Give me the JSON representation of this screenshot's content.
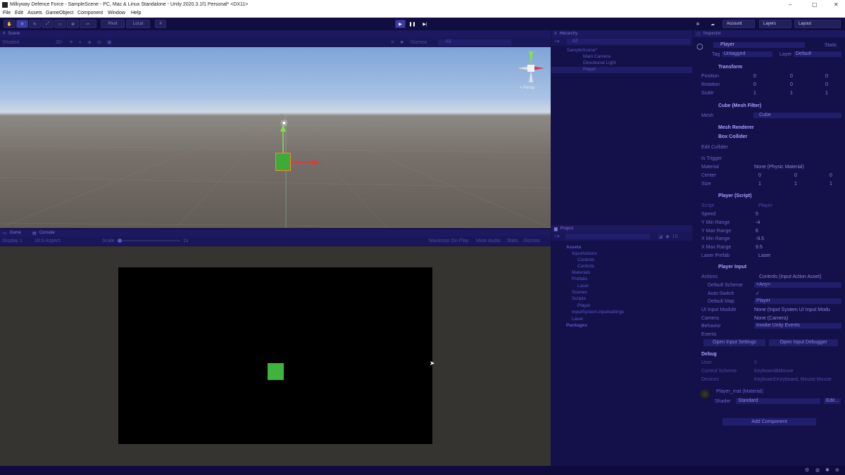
{
  "window": {
    "title": "Milkyway Defence Force - SampleScene - PC, Mac & Linux Standalone - Unity 2020.3.1f1 Personal* <DX11>",
    "min": "–",
    "max": "▢",
    "close": "✕"
  },
  "menu": [
    "File",
    "Edit",
    "Assets",
    "GameObject",
    "Component",
    "Window",
    "Help"
  ],
  "toolbar": {
    "pivot": "Pivot",
    "local": "Local",
    "account": "Account",
    "layers": "Layers",
    "layout": "Layout"
  },
  "scene": {
    "tab": "Scene",
    "shading": "Shaded",
    "twod": "2D",
    "gizmos": "Gizmos",
    "search": "All",
    "persp": "< Persp"
  },
  "game": {
    "tab_game": "Game",
    "tab_console": "Console",
    "display": "Display 1",
    "aspect": "16:9 Aspect",
    "scale_label": "Scale",
    "scale_value": "1x",
    "maximize": "Maximize On Play",
    "mute": "Mute Audio",
    "stats": "Stats",
    "gizmos": "Gizmos"
  },
  "hierarchy": {
    "tab": "Hierarchy",
    "search": "All",
    "items": [
      {
        "label": "SampleScene*",
        "depth": 0
      },
      {
        "label": "Main Camera",
        "depth": 1
      },
      {
        "label": "Directional Light",
        "depth": 1
      },
      {
        "label": "Player",
        "depth": 1
      }
    ]
  },
  "project": {
    "tab": "Project",
    "count": "10",
    "items": [
      {
        "label": "Assets",
        "depth": 0,
        "bold": true
      },
      {
        "label": "InputActions",
        "depth": 1
      },
      {
        "label": "Controls",
        "depth": 2
      },
      {
        "label": "Controls",
        "depth": 2
      },
      {
        "label": "Materials",
        "depth": 1
      },
      {
        "label": "Prefabs",
        "depth": 1
      },
      {
        "label": "Laser",
        "depth": 2
      },
      {
        "label": "Scenes",
        "depth": 1
      },
      {
        "label": "Scripts",
        "depth": 1
      },
      {
        "label": "Player",
        "depth": 2
      },
      {
        "label": "InputSystem.inputsettings",
        "depth": 1
      },
      {
        "label": "Laser",
        "depth": 1
      },
      {
        "label": "Packages",
        "depth": 0,
        "bold": true
      }
    ]
  },
  "inspector": {
    "tab": "Inspector",
    "name": "Player",
    "static": "Static",
    "tag_label": "Tag",
    "tag": "Untagged",
    "layer_label": "Layer",
    "layer": "Default",
    "transform": {
      "title": "Transform",
      "rows": [
        {
          "label": "Position",
          "x": "0",
          "y": "0",
          "z": "0"
        },
        {
          "label": "Rotation",
          "x": "0",
          "y": "0",
          "z": "0"
        },
        {
          "label": "Scale",
          "x": "1",
          "y": "1",
          "z": "1"
        }
      ]
    },
    "meshfilter": {
      "title": "Cube (Mesh Filter)",
      "mesh_label": "Mesh",
      "mesh": "Cube"
    },
    "renderer": {
      "title": "Mesh Renderer"
    },
    "collider": {
      "title": "Box Collider",
      "edit": "Edit Collider",
      "trigger": "Is Trigger",
      "material_label": "Material",
      "material": "None (Physic Material)",
      "center_label": "Center",
      "center": {
        "x": "0",
        "y": "0",
        "z": "0"
      },
      "size_label": "Size",
      "size": {
        "x": "1",
        "y": "1",
        "z": "1"
      }
    },
    "script": {
      "title": "Player (Script)",
      "script_label": "Script",
      "script": "Player",
      "rows": [
        {
          "label": "Speed",
          "value": "5"
        },
        {
          "label": "Y Min Range",
          "value": "-4"
        },
        {
          "label": "Y Max Range",
          "value": "6"
        },
        {
          "label": "X Min Range",
          "value": "-9.5"
        },
        {
          "label": "X Max Range",
          "value": "9.5"
        },
        {
          "label": "Laser Prefab",
          "value": "Laser"
        }
      ]
    },
    "playerinput": {
      "title": "Player Input",
      "actions_label": "Actions",
      "actions": "Controls (Input Action Asset)",
      "scheme_label": "Default Scheme",
      "scheme": "<Any>",
      "autoswitch_label": "Auto-Switch",
      "map_label": "Default Map",
      "map": "Player",
      "ui_label": "UI Input Module",
      "ui": "None (Input System UI Input Modu",
      "camera_label": "Camera",
      "camera": "None (Camera)",
      "behavior_label": "Behavior",
      "behavior": "Invoke Unity Events",
      "events": "Events",
      "open_settings": "Open Input Settings",
      "open_debugger": "Open Input Debugger",
      "debug": "Debug",
      "user_label": "User",
      "user": "0",
      "scheme2_label": "Control Scheme",
      "scheme2": "Keyboard&Mouse",
      "devices_label": "Devices",
      "devices": "Keyboard:Keyboard, Mouse:Mouse"
    },
    "material": {
      "title": "Player_mat (Material)",
      "shader_label": "Shader",
      "shader": "Standard",
      "edit": "Edit..."
    },
    "add_component": "Add Component"
  },
  "colors": {
    "accent": "#3b3aa8",
    "cube": "#3fb33c",
    "panel": "#14114a"
  }
}
